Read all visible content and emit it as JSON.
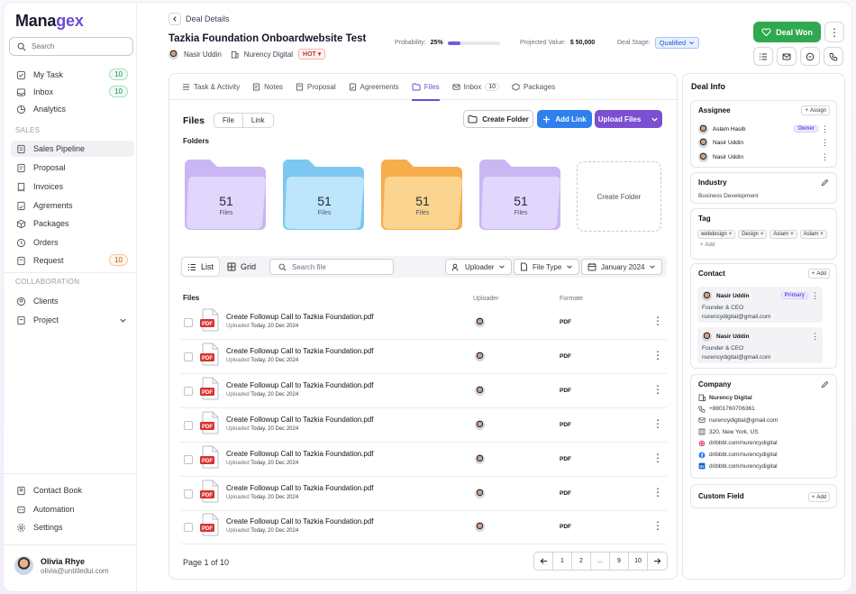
{
  "app": {
    "logo_main": "Mana",
    "logo_accent": "gex"
  },
  "sidebar": {
    "search_placeholder": "Search",
    "top_items": [
      {
        "label": "My Task",
        "badge": "10"
      },
      {
        "label": "Inbox",
        "badge": "10"
      },
      {
        "label": "Analytics",
        "badge": ""
      }
    ],
    "sales_label": "SALES",
    "sales_items": [
      {
        "label": "Sales Pipeline",
        "badge": ""
      },
      {
        "label": "Proposal",
        "badge": ""
      },
      {
        "label": "Invoices",
        "badge": ""
      },
      {
        "label": "Agrements",
        "badge": ""
      },
      {
        "label": "Packages",
        "badge": ""
      },
      {
        "label": "Orders",
        "badge": ""
      },
      {
        "label": "Request",
        "badge": "10"
      }
    ],
    "collab_label": "COLLABORATION",
    "collab_items": [
      {
        "label": "Clients"
      },
      {
        "label": "Project"
      }
    ],
    "bottom_items": [
      {
        "label": "Contact Book"
      },
      {
        "label": "Automation"
      },
      {
        "label": "Settings"
      }
    ],
    "user": {
      "name": "Olivia Rhye",
      "email": "olivia@untitledui.com"
    }
  },
  "header": {
    "breadcrumb": "Deal Details",
    "title": "Tazkia Foundation Onboardwebsite Test",
    "owner": "Nasir Uddin",
    "company": "Nurency Digital",
    "priority": "HOT",
    "probability_label": "Probability:",
    "probability_value": "25%",
    "probability_fraction": 0.25,
    "projected_label": "Projected Value:",
    "projected_value": "$ 50,000",
    "stage_label": "Deal Stage:",
    "stage_value": "Qualified",
    "deal_won_label": "Deal Won"
  },
  "tabs": [
    {
      "label": "Task & Activity",
      "icon": "list-icon"
    },
    {
      "label": "Notes",
      "icon": "note-icon"
    },
    {
      "label": "Proposal",
      "icon": "document-icon"
    },
    {
      "label": "Agreements",
      "icon": "document-icon"
    },
    {
      "label": "Files",
      "icon": "folder-icon"
    },
    {
      "label": "Inbox",
      "icon": "mail-icon",
      "count": "10"
    },
    {
      "label": "Packages",
      "icon": "package-icon"
    }
  ],
  "files_panel": {
    "title": "Files",
    "segment": [
      "File",
      "Link"
    ],
    "create_folder": "Create Folder",
    "add_link": "Add Link",
    "upload_files": "Upload Files",
    "folders_label": "Folders",
    "folders": [
      {
        "count": "51",
        "label": "Files",
        "color": "#c9b6f3",
        "front": "#e1d6fb"
      },
      {
        "count": "51",
        "label": "Files",
        "color": "#7cc8f2",
        "front": "#bde5fb"
      },
      {
        "count": "51",
        "label": "Files",
        "color": "#f6ad4b",
        "front": "#fbd48f"
      },
      {
        "count": "51",
        "label": "Files",
        "color": "#c9b6f3",
        "front": "#e1d6fb"
      }
    ],
    "create_folder_tile": "Create Folder",
    "view_list": "List",
    "view_grid": "Grid",
    "search_placeholder": "Search file",
    "filter_uploader": "Uploader",
    "filter_type": "File Type",
    "filter_date": "January 2024",
    "col_files": "Files",
    "col_uploader": "Uploader",
    "col_format": "Formate",
    "rows": [
      {
        "name": "Create Followup Call to Tazkia Foundation.pdf",
        "uploaded_prefix": "Uploaded",
        "date": "Today, 20 Dec 2024",
        "format": "PDF"
      },
      {
        "name": "Create Followup Call to Tazkia Foundation.pdf",
        "uploaded_prefix": "Uploaded",
        "date": "Today, 20 Dec 2024",
        "format": "PDF"
      },
      {
        "name": "Create Followup Call to Tazkia Foundation.pdf",
        "uploaded_prefix": "Uploaded",
        "date": "Today, 20 Dec 2024",
        "format": "PDF"
      },
      {
        "name": "Create Followup Call to Tazkia Foundation.pdf",
        "uploaded_prefix": "Uploaded",
        "date": "Today, 20 Dec 2024",
        "format": "PDF"
      },
      {
        "name": "Create Followup Call to Tazkia Foundation.pdf",
        "uploaded_prefix": "Uploaded",
        "date": "Today, 20 Dec 2024",
        "format": "PDF"
      },
      {
        "name": "Create Followup Call to Tazkia Foundation.pdf",
        "uploaded_prefix": "Uploaded",
        "date": "Today, 20 Dec 2024",
        "format": "PDF"
      },
      {
        "name": "Create Followup Call to Tazkia Foundation.pdf",
        "uploaded_prefix": "Uploaded",
        "date": "Today, 20 Dec 2024",
        "format": "PDF"
      }
    ],
    "page_text": "Page 1 of 10",
    "pages": [
      "1",
      "2",
      "...",
      "9",
      "10"
    ]
  },
  "deal_info": {
    "title": "Deal Info",
    "assignee_title": "Assignee",
    "assign_btn": "Assign",
    "assignees": [
      {
        "name": "Aslam Hasib",
        "tag": "Owner"
      },
      {
        "name": "Nasir Uddin",
        "tag": ""
      },
      {
        "name": "Nasir Uddin",
        "tag": ""
      }
    ],
    "industry_title": "Industry",
    "industry_value": "Business Development",
    "tag_title": "Tag",
    "tags": [
      "webdesign",
      "Design",
      "Aslam",
      "Aslam"
    ],
    "tag_add": "Add",
    "contact_title": "Contact",
    "contact_add": "Add",
    "contacts": [
      {
        "name": "Nasir Uddin",
        "primary": "Primary",
        "role": "Founder & CEO",
        "email": "nurencydigital@gmail.com"
      },
      {
        "name": "Nasir Uddin",
        "primary": "",
        "role": "Founder & CEO",
        "email": "nurencydigital@gmail.com"
      }
    ],
    "company_title": "Company",
    "company_lines": [
      {
        "icon": "building-icon",
        "text": "Nurency Digital"
      },
      {
        "icon": "phone-icon",
        "text": "+8801760706361"
      },
      {
        "icon": "mail-icon",
        "text": "nurencydigital@gmail.com"
      },
      {
        "icon": "location-icon",
        "text": "320, New York, US"
      },
      {
        "icon": "dribbble-icon",
        "text": "dribbbl.com/nurencydigital"
      },
      {
        "icon": "facebook-icon",
        "text": "dribbbl.com/nurencydigital"
      },
      {
        "icon": "linkedin-icon",
        "text": "dribbbl.com/nurencydigital"
      }
    ],
    "custom_field_title": "Custom Field",
    "custom_field_add": "Add"
  }
}
